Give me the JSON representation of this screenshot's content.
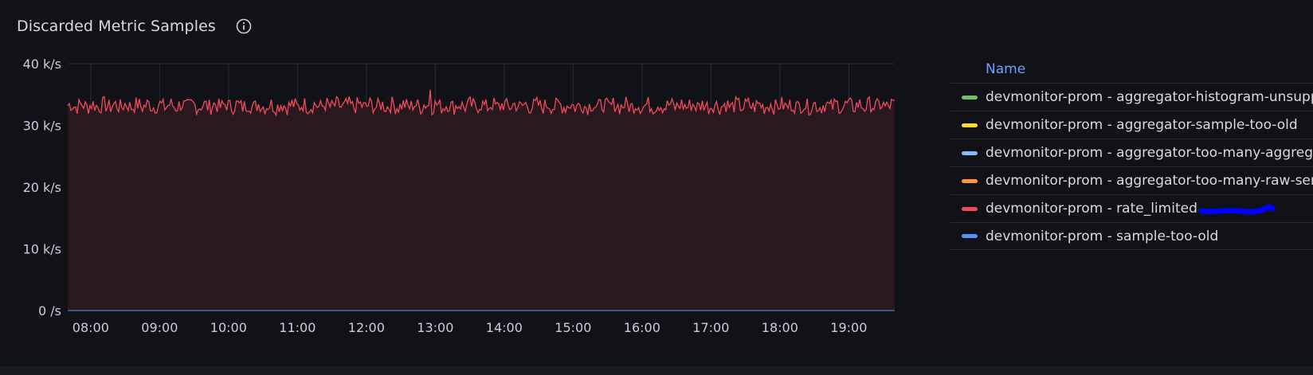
{
  "panel": {
    "title": "Discarded Metric Samples"
  },
  "icons": {
    "info": "info-circle-icon"
  },
  "colors": {
    "background": "#111217",
    "grid": "#2a2b33",
    "series_rate_limited": "#f2495c",
    "area_fill": "#2a181f"
  },
  "chart_data": {
    "type": "line",
    "title": "Discarded Metric Samples",
    "xlabel": "",
    "ylabel": "",
    "x_ticks": [
      "08:00",
      "09:00",
      "10:00",
      "11:00",
      "12:00",
      "13:00",
      "14:00",
      "15:00",
      "16:00",
      "17:00",
      "18:00",
      "19:00"
    ],
    "x_range": [
      "07:40",
      "19:40"
    ],
    "y_ticks": [
      "0 /s",
      "10 k/s",
      "20 k/s",
      "30 k/s",
      "40 k/s"
    ],
    "ylim": [
      0,
      40
    ],
    "y_unit": "k/s",
    "grid": true,
    "legend_placement": "right",
    "series": [
      {
        "name": "devmonitor-prom - aggregator-histogram-unsupported",
        "color": "#73bf69",
        "values_constant": 0
      },
      {
        "name": "devmonitor-prom - aggregator-sample-too-old",
        "color": "#fade2a",
        "values_constant": 0
      },
      {
        "name": "devmonitor-prom - aggregator-too-many-aggregated-series",
        "color": "#8ab8ff",
        "values_constant": 0
      },
      {
        "name": "devmonitor-prom - aggregator-too-many-raw-series",
        "color": "#ff9830",
        "values_constant": 0
      },
      {
        "name": "devmonitor-prom - rate_limited",
        "color": "#f2495c",
        "mean": 33.2,
        "min": 30.8,
        "max": 35.8,
        "fill": true
      },
      {
        "name": "devmonitor-prom - sample-too-old",
        "color": "#5794f2",
        "values_constant": 0
      }
    ]
  },
  "legend": {
    "header": "Name",
    "items": [
      {
        "label": "devmonitor-prom - aggregator-histogram-unsupported",
        "color": "#73bf69"
      },
      {
        "label": "devmonitor-prom - aggregator-sample-too-old",
        "color": "#fade2a"
      },
      {
        "label": "devmonitor-prom - aggregator-too-many-aggregated-series",
        "color": "#8ab8ff"
      },
      {
        "label": "devmonitor-prom - aggregator-too-many-raw-series",
        "color": "#ff9830"
      },
      {
        "label": "devmonitor-prom - rate_limited",
        "color": "#f2495c"
      },
      {
        "label": "devmonitor-prom - sample-too-old",
        "color": "#5794f2"
      }
    ]
  }
}
